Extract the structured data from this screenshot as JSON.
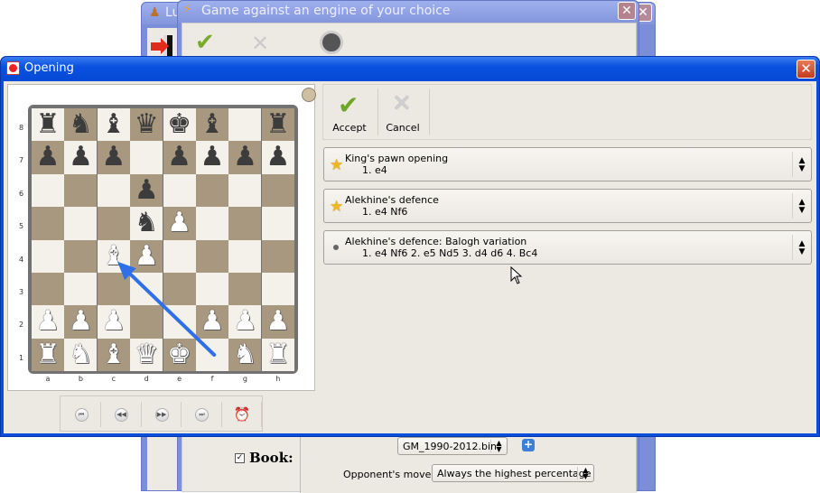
{
  "background_windows": {
    "lucas_window": {
      "title": "Lu"
    },
    "engine_dialog": {
      "title": "Game against an engine of your choice",
      "close_label": "✕",
      "book_label": "Book:",
      "book_checked": true,
      "book_file": "GM_1990-2012.bin",
      "opponent_move_label": "Opponent's move:",
      "opponent_move_value": "Always the highest percentage"
    }
  },
  "dialog": {
    "title": "Opening",
    "close_label": "✕"
  },
  "toolbar": {
    "accept_label": "Accept",
    "cancel_label": "Cancel"
  },
  "board": {
    "files": [
      "a",
      "b",
      "c",
      "d",
      "e",
      "f",
      "g",
      "h"
    ],
    "ranks": [
      "8",
      "7",
      "6",
      "5",
      "4",
      "3",
      "2",
      "1"
    ],
    "pieces": [
      {
        "sq": "a8",
        "p": "♜",
        "c": "b"
      },
      {
        "sq": "b8",
        "p": "♞",
        "c": "b"
      },
      {
        "sq": "c8",
        "p": "♝",
        "c": "b"
      },
      {
        "sq": "d8",
        "p": "♛",
        "c": "b"
      },
      {
        "sq": "e8",
        "p": "♚",
        "c": "b"
      },
      {
        "sq": "f8",
        "p": "♝",
        "c": "b"
      },
      {
        "sq": "h8",
        "p": "♜",
        "c": "b"
      },
      {
        "sq": "a7",
        "p": "♟",
        "c": "b"
      },
      {
        "sq": "b7",
        "p": "♟",
        "c": "b"
      },
      {
        "sq": "c7",
        "p": "♟",
        "c": "b"
      },
      {
        "sq": "e7",
        "p": "♟",
        "c": "b"
      },
      {
        "sq": "f7",
        "p": "♟",
        "c": "b"
      },
      {
        "sq": "g7",
        "p": "♟",
        "c": "b"
      },
      {
        "sq": "h7",
        "p": "♟",
        "c": "b"
      },
      {
        "sq": "d6",
        "p": "♟",
        "c": "b"
      },
      {
        "sq": "d5",
        "p": "♞",
        "c": "b"
      },
      {
        "sq": "e5",
        "p": "♟",
        "c": "w"
      },
      {
        "sq": "c4",
        "p": "♝",
        "c": "w"
      },
      {
        "sq": "d4",
        "p": "♟",
        "c": "w"
      },
      {
        "sq": "a2",
        "p": "♟",
        "c": "w"
      },
      {
        "sq": "b2",
        "p": "♟",
        "c": "w"
      },
      {
        "sq": "c2",
        "p": "♟",
        "c": "w"
      },
      {
        "sq": "f2",
        "p": "♟",
        "c": "w"
      },
      {
        "sq": "g2",
        "p": "♟",
        "c": "w"
      },
      {
        "sq": "h2",
        "p": "♟",
        "c": "w"
      },
      {
        "sq": "a1",
        "p": "♜",
        "c": "w"
      },
      {
        "sq": "b1",
        "p": "♞",
        "c": "w"
      },
      {
        "sq": "c1",
        "p": "♝",
        "c": "w"
      },
      {
        "sq": "d1",
        "p": "♛",
        "c": "w"
      },
      {
        "sq": "e1",
        "p": "♚",
        "c": "w"
      },
      {
        "sq": "g1",
        "p": "♞",
        "c": "w"
      },
      {
        "sq": "h1",
        "p": "♜",
        "c": "w"
      }
    ],
    "last_move_arrow": {
      "from": "f1",
      "to": "c4",
      "color": "#2f6fe8"
    },
    "side_to_move_indicator_color": "#cdbfa0"
  },
  "nav": {
    "buttons": [
      {
        "name": "first-move-button",
        "icon": "⏮"
      },
      {
        "name": "previous-move-button",
        "icon": "◀◀"
      },
      {
        "name": "next-move-button",
        "icon": "▶▶"
      },
      {
        "name": "last-move-button",
        "icon": "⏭"
      },
      {
        "name": "autoplay-button",
        "icon": "⏰"
      }
    ]
  },
  "openings": [
    {
      "name": "King's pawn opening",
      "moves": "1. e4",
      "marker": "star"
    },
    {
      "name": "Alekhine's defence",
      "moves": "1. e4 Nf6",
      "marker": "star"
    },
    {
      "name": "Alekhine's defence: Balogh variation",
      "moves": "1. e4 Nf6 2. e5 Nd5 3. d4 d6 4. Bc4",
      "marker": "dot"
    }
  ]
}
